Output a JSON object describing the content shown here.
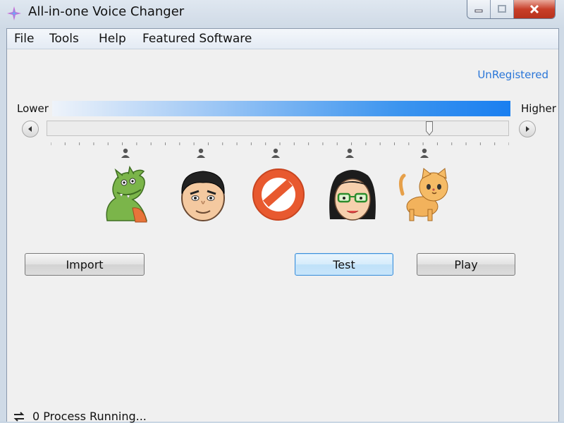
{
  "window": {
    "title": "All-in-one Voice Changer"
  },
  "menu": [
    "File",
    "Tools",
    "Help",
    "Featured Software"
  ],
  "registration": {
    "status": "UnRegistered"
  },
  "pitch": {
    "lower_label": "Lower",
    "higher_label": "Higher",
    "slider_fraction": 0.83
  },
  "voices": [
    {
      "name": "dragon",
      "icon": "dragon-icon"
    },
    {
      "name": "man",
      "icon": "man-face-icon"
    },
    {
      "name": "none",
      "icon": "no-sign-icon"
    },
    {
      "name": "woman",
      "icon": "woman-face-icon"
    },
    {
      "name": "cat",
      "icon": "cat-icon"
    }
  ],
  "buttons": {
    "import": "Import",
    "test": "Test",
    "play": "Play"
  },
  "status_bar": {
    "text": "0 Process Running..."
  },
  "colors": {
    "accent": "#1a7ff0",
    "link": "#2a76d8",
    "close": "#c8402a"
  }
}
